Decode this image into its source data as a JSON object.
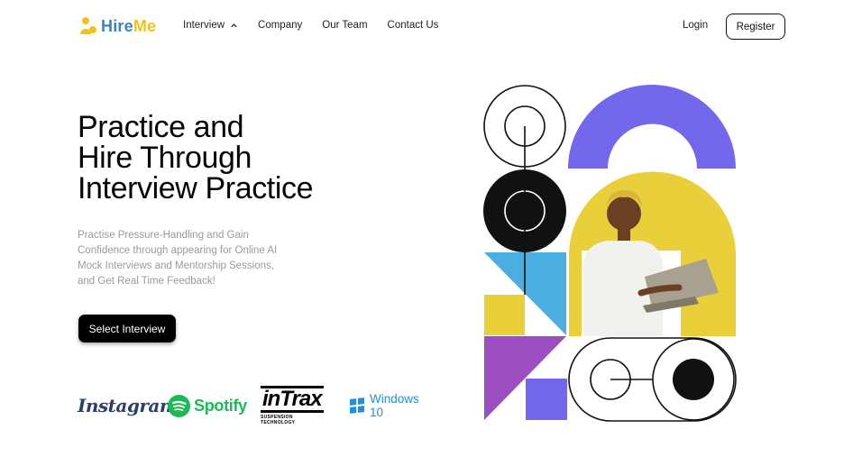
{
  "brand": {
    "name_part1": "Hire",
    "name_part2": "Me",
    "logo_icon": "person-pin-icon",
    "colors": {
      "primary": "#3b82c4",
      "accent": "#f2c21a"
    }
  },
  "nav": {
    "items": [
      {
        "label": "Interview",
        "icon": "chevron-up-icon"
      },
      {
        "label": "Company"
      },
      {
        "label": "Our Team"
      },
      {
        "label": "Contact Us"
      }
    ],
    "login_label": "Login",
    "register_label": "Register"
  },
  "hero": {
    "title_lines": [
      "Practice and",
      "Hire Through",
      "Interview Practice"
    ],
    "subtitle": "Practise Pressure-Handling and Gain Confidence through appearing for Online AI Mock Interviews and Mentorship Sessions, and Get Real Time Feedback!",
    "cta_label": "Select Interview"
  },
  "brands": {
    "instagram": "Instagram",
    "spotify": "Spotify",
    "intrax": "inTrax",
    "intrax_tagline": "SUSPENSION TECHNOLOGY",
    "windows": "Windows 10"
  },
  "art": {
    "colors": {
      "purple": "#7367ec",
      "yellow": "#e9cf3a",
      "sky": "#4aaee0",
      "violet": "#9d4fc2",
      "black": "#111111"
    },
    "photo_icon": "person-with-laptop-icon"
  }
}
